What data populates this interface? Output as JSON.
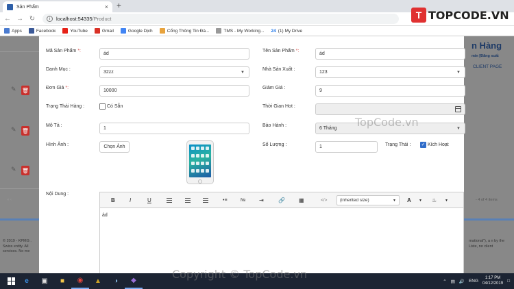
{
  "browser": {
    "tab_title": "Sản Phẩm",
    "tab_close": "×",
    "new_tab": "+",
    "url_host": "localhost:54335",
    "url_path": "/Product",
    "bookmarks": [
      {
        "label": "Apps",
        "color": "#4a7bd0"
      },
      {
        "label": "Facebook",
        "color": "#3b5998"
      },
      {
        "label": "YouTube",
        "color": "#e62117"
      },
      {
        "label": "Gmail",
        "color": "#d93025"
      },
      {
        "label": "Google Dịch",
        "color": "#4285f4"
      },
      {
        "label": "Cổng Thông Tin Đà...",
        "color": "#e8a33d"
      },
      {
        "label": "TMS - My Working...",
        "color": "#999999"
      },
      {
        "label": "(1) My Drive",
        "color": "#1a73e8"
      }
    ],
    "bookmark_24": "24"
  },
  "logo": {
    "mark": "T",
    "text": "TOPCODE.VN"
  },
  "background": {
    "title": "n Hàng",
    "small": "min [Đăng xuất",
    "client": "CLIENT PAGE",
    "pagination": "- 4 of 4 items",
    "footer_left": "© 2019 - KPMG . Swiss entity. All services. No me",
    "footer_right": "rnational\"), a n by the Liste, no client"
  },
  "form": {
    "ma_sp_label": "Mã Sản Phẩm",
    "req": "*:",
    "ma_sp_value": "ád",
    "ten_sp_label": "Tên Sản Phẩm",
    "ten_sp_value": "ád",
    "danh_muc_label": "Danh Mục :",
    "danh_muc_value": "32zz",
    "nsx_label": "Nhà Sản Xuất :",
    "nsx_value": "123",
    "don_gia_label": "Đơn Giá",
    "don_gia_value": "10000",
    "giam_gia_label": "Giảm Giá :",
    "giam_gia_value": "9",
    "trang_thai_hang_label": "Trạng Thái Hàng :",
    "co_san_label": "Có Sẵn",
    "thoi_gian_hot_label": "Thời Gian Hot :",
    "mo_ta_label": "Mô Tả :",
    "mo_ta_value": "1",
    "bao_hanh_label": "Bảo Hành :",
    "bao_hanh_value": "6 Tháng",
    "hinh_anh_label": "Hình Ảnh :",
    "chon_anh_button": "Chọn Ảnh",
    "so_luong_label": "Số Lượng :",
    "so_luong_value": "1",
    "trang_thai_label": "Trạng Thái :",
    "kich_hoat_label": "Kích Hoạt",
    "noi_dung_label": "Nội Dung :"
  },
  "editor": {
    "bold": "B",
    "italic": "I",
    "underline": "U",
    "code": "</>",
    "size_select": "(inherited size)",
    "color_btn": "A",
    "content": "ád"
  },
  "taskbar": {
    "lang": "ENG",
    "time": "1:17 PM",
    "date": "04/12/2019"
  },
  "watermarks": {
    "center": "TopCode.vn",
    "bottom": "Copyright © TopCode.vn"
  }
}
